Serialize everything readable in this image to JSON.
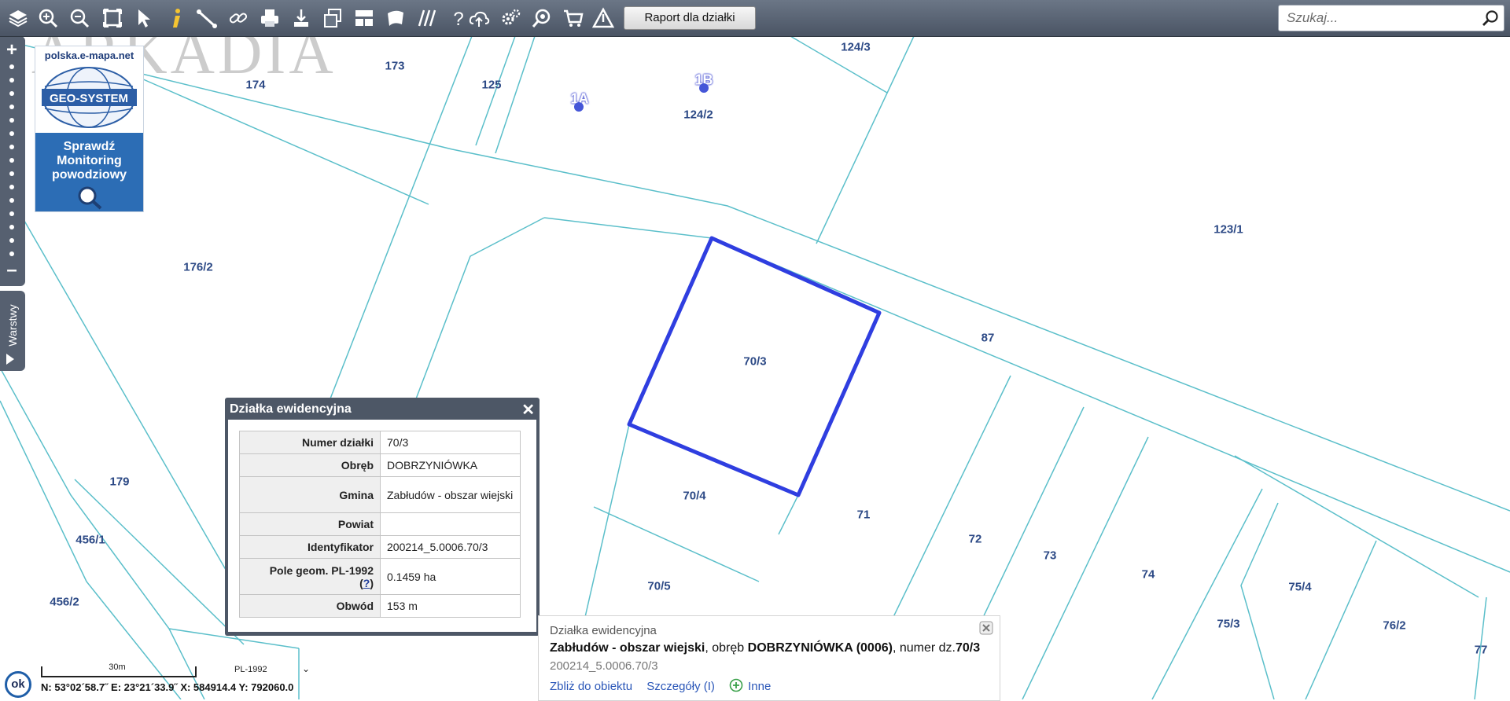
{
  "toolbar": {
    "report_button": "Raport dla działki",
    "search_placeholder": "Szukaj..."
  },
  "watermark": "ARKADIA",
  "geo_logo": {
    "site": "polska.e-mapa.net",
    "brand": "GEO-SYSTEM",
    "promo_line1": "Sprawdź",
    "promo_line2": "Monitoring",
    "promo_line3": "powodziowy"
  },
  "zoom": {
    "plus": "+",
    "minus": "–"
  },
  "layers_tab": "Warstwy",
  "map_labels": [
    "124/3",
    "174",
    "173",
    "125",
    "124/2",
    "123/1",
    "176/2",
    "87",
    "70/3",
    "70/4",
    "71",
    "72",
    "73",
    "74",
    "75/4",
    "75/3",
    "76/2",
    "77",
    "70/5",
    "179",
    "456/1",
    "456/2"
  ],
  "map_points": [
    "1A",
    "1B"
  ],
  "dialog": {
    "title": "Działka ewidencyjna",
    "close": "✕",
    "rows": [
      {
        "key": "Numer działki",
        "value": "70/3"
      },
      {
        "key": "Obręb",
        "value": "DOBRZYNIÓWKA"
      },
      {
        "key": "Gmina",
        "value": "Zabłudów - obszar wiejski"
      },
      {
        "key": "Powiat",
        "value": ""
      },
      {
        "key": "Identyfikator",
        "value": "200214_5.0006.70/3"
      },
      {
        "key": "Pole geom. PL-1992",
        "value": "0.1459 ha"
      },
      {
        "key": "Obwód",
        "value": "153 m"
      }
    ],
    "help_link": "?"
  },
  "info": {
    "type": "Działka ewidencyjna",
    "gmina": "Zabłudów - obszar wiejski",
    "text_obreb": ", obręb ",
    "obreb": "DOBRZYNIÓWKA (0006)",
    "text_numer": ", numer dz.",
    "numer": "70/3",
    "identifier": "200214_5.0006.70/3",
    "action_zoom": "Zbliż do obiektu",
    "action_details": "Szczegóły (I)",
    "action_other": "Inne"
  },
  "status": {
    "ok": "ok",
    "scale": "30m",
    "crs": "PL-1992",
    "coords": "N: 53°02´58.7˝ E: 23°21´33.9˝ X: 584914.4  Y: 792060.0"
  },
  "colors": {
    "toolbar": "#566070",
    "parcel_lines": "#5bbfca",
    "selected_parcel": "#2f3ee0",
    "label": "#2d4a86"
  }
}
